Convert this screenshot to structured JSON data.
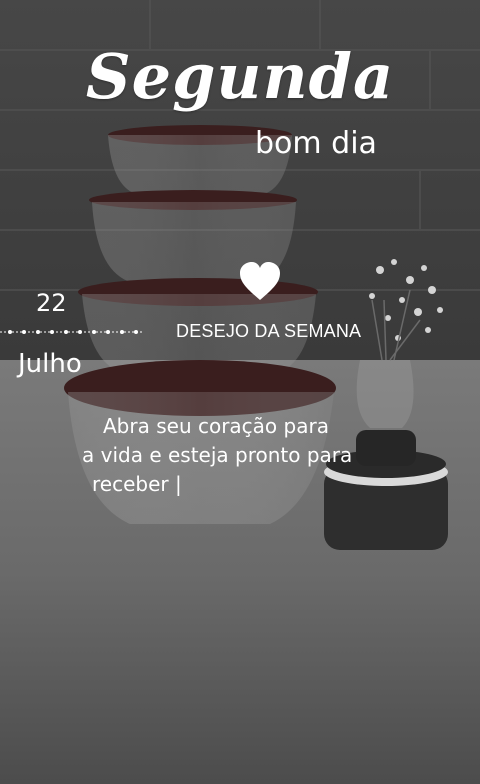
{
  "story": {
    "title": "Segunda",
    "subtitle": "bom dia",
    "date": {
      "day": "22",
      "month": "Julho"
    },
    "heading": "DESEJO DA SEMANA",
    "message_lines": [
      "Abra seu coração para",
      "a vida e esteja pronto para",
      "receber |"
    ]
  },
  "icons": {
    "heart": "heart-icon",
    "divider": "decorative-divider"
  },
  "colors": {
    "text": "#ffffff",
    "lid": "#3a1e1e",
    "background": "#4a4a4a"
  }
}
